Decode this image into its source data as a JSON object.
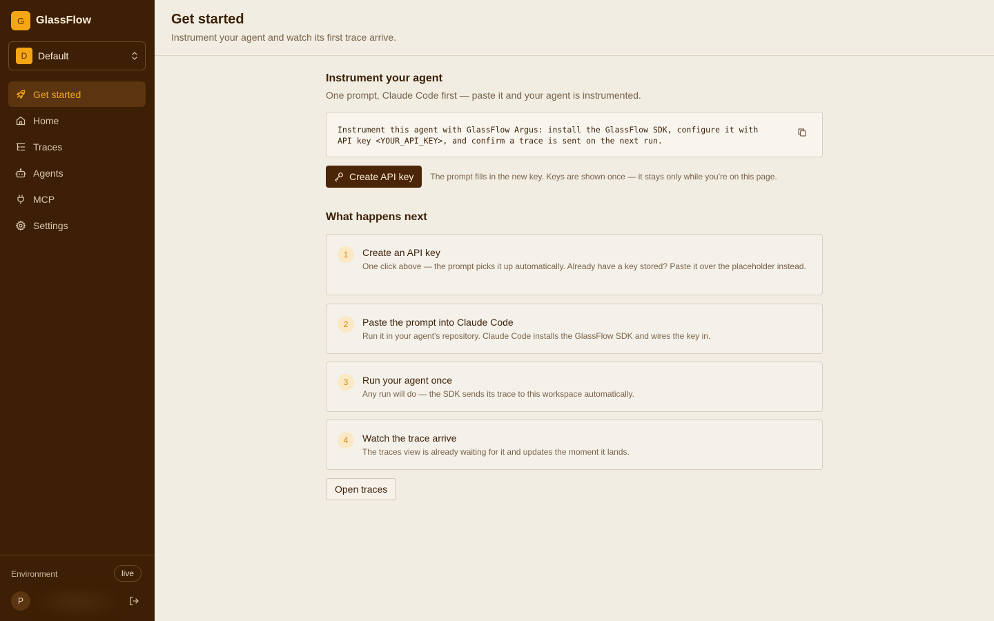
{
  "brand": {
    "logo_letter": "G",
    "name": "GlassFlow"
  },
  "workspace": {
    "badge": "D",
    "name": "Default"
  },
  "nav": [
    {
      "label": "Get started",
      "icon": "rocket-icon",
      "active": true
    },
    {
      "label": "Home",
      "icon": "home-icon"
    },
    {
      "label": "Traces",
      "icon": "list-tree-icon"
    },
    {
      "label": "Agents",
      "icon": "robot-icon"
    },
    {
      "label": "MCP",
      "icon": "plug-icon"
    },
    {
      "label": "Settings",
      "icon": "gear-icon"
    }
  ],
  "footer": {
    "env_label": "Environment",
    "env_badge": "live",
    "avatar_letter": "P"
  },
  "header": {
    "title": "Get started",
    "subtitle": "Instrument your agent and watch its first trace arrive."
  },
  "instrument": {
    "title": "Instrument your agent",
    "subtitle": "One prompt, Claude Code first — paste it and your agent is instrumented.",
    "prompt_line1": "Instrument this agent with GlassFlow Argus: install the GlassFlow SDK, configure it with",
    "prompt_line2": "API key <YOUR_API_KEY>, and confirm a trace is sent on the next run.",
    "create_key_label": "Create API key",
    "note": "The prompt fills in the new key. Keys are shown once — it stays only while you're on this page."
  },
  "next": {
    "title": "What happens next",
    "steps": [
      {
        "num": "1",
        "title": "Create an API key",
        "desc": "One click above — the prompt picks it up automatically. Already have a key stored? Paste it over the placeholder instead."
      },
      {
        "num": "2",
        "title": "Paste the prompt into Claude Code",
        "desc": "Run it in your agent's repository. Claude Code installs the GlassFlow SDK and wires the key in."
      },
      {
        "num": "3",
        "title": "Run your agent once",
        "desc": "Any run will do — the SDK sends its trace to this workspace automatically."
      },
      {
        "num": "4",
        "title": "Watch the trace arrive",
        "desc": "The traces view is already waiting for it and updates the moment it lands."
      }
    ],
    "open_traces_label": "Open traces"
  },
  "colors": {
    "sidebar": "#3c1f04",
    "accent": "#f5a614",
    "background": "#f1ede3",
    "primary_button": "#4a2508"
  }
}
